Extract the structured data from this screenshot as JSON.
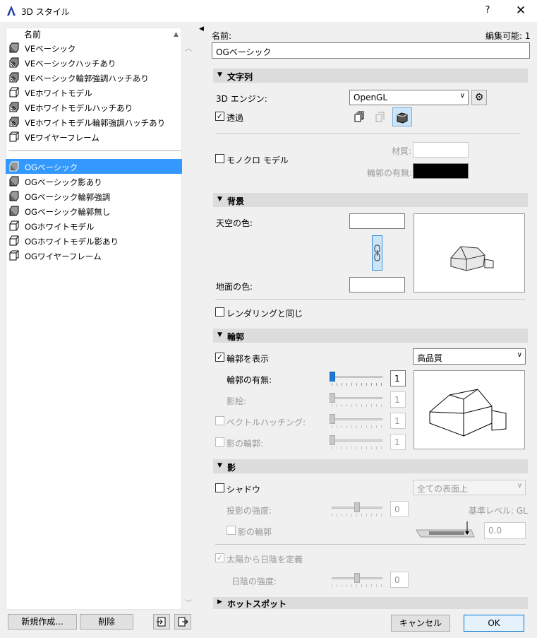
{
  "window": {
    "title": "3D スタイル",
    "help": "?",
    "close": "✕"
  },
  "list": {
    "header": "名前",
    "group1": [
      {
        "label": "VEベーシック",
        "icon": "ve-basic-icon"
      },
      {
        "label": "VEベーシックハッチあり",
        "icon": "ve-hatch-icon"
      },
      {
        "label": "VEベーシック輪郭強調ハッチあり",
        "icon": "ve-hatch-icon"
      },
      {
        "label": "VEホワイトモデル",
        "icon": "ve-white-icon"
      },
      {
        "label": "VEホワイトモデルハッチあり",
        "icon": "ve-hatch-icon"
      },
      {
        "label": "VEホワイトモデル輪郭強調ハッチあり",
        "icon": "ve-hatch-icon"
      },
      {
        "label": "VEワイヤーフレーム",
        "icon": "wireframe-icon"
      }
    ],
    "group2": [
      {
        "label": "OGベーシック",
        "icon": "og-basic-icon",
        "selected": true
      },
      {
        "label": "OGベーシック影あり",
        "icon": "og-basic-icon"
      },
      {
        "label": "OGベーシック輪郭強調",
        "icon": "og-basic-icon"
      },
      {
        "label": "OGベーシック輪郭無し",
        "icon": "og-basic-icon"
      },
      {
        "label": "OGホワイトモデル",
        "icon": "og-white-icon"
      },
      {
        "label": "OGホワイトモデル影あり",
        "icon": "og-white-icon"
      },
      {
        "label": "OGワイヤーフレーム",
        "icon": "wireframe-icon"
      }
    ],
    "new_button": "新規作成...",
    "delete_button": "削除"
  },
  "name": {
    "label": "名前:",
    "value": "OGベーシック",
    "editable": "編集可能: 1"
  },
  "engine_section": {
    "title": "文字列",
    "engine_label": "3D エンジン:",
    "engine_value": "OpenGL",
    "transparency_label": "透過",
    "transparency_checked": "✓",
    "mono_label": "モノクロ モデル",
    "material_label": "材質:",
    "contour_label": "輪郭の有無:",
    "contour_color": "#000000"
  },
  "background_section": {
    "title": "背景",
    "sky_label": "天空の色:",
    "ground_label": "地面の色:",
    "same_as_render_label": "レンダリングと同じ"
  },
  "contour_section": {
    "title": "輪郭",
    "show_contours_label": "輪郭を表示",
    "show_contours_checked": "✓",
    "quality_value": "高品質",
    "contour_presence_label": "輪郭の有無:",
    "contour_presence_value": "1",
    "shading_label": "影絵:",
    "shading_value": "1",
    "vector_hatch_label": "ベクトルハッチング:",
    "vector_hatch_value": "1",
    "shadow_contour_label": "影の輪郭:",
    "shadow_contour_value": "1"
  },
  "shadow_section": {
    "title": "影",
    "shadow_label": "シャドウ",
    "surfaces_value": "全ての表面上",
    "cast_intensity_label": "投影の強度:",
    "cast_intensity_value": "0",
    "base_level_label": "基準レベル: GL",
    "shadow_contour_label": "影の輪郭",
    "level_value": "0.0",
    "sun_label": "太陽から日陰を定義",
    "sun_checked": "✓",
    "shade_intensity_label": "日陰の強度:",
    "shade_intensity_value": "0"
  },
  "hotspot_section": {
    "title": "ホットスポット"
  },
  "buttons": {
    "cancel": "キャンセル",
    "ok": "OK"
  },
  "colors": {
    "accent": "#3399ff",
    "selection": "#3399ff"
  }
}
